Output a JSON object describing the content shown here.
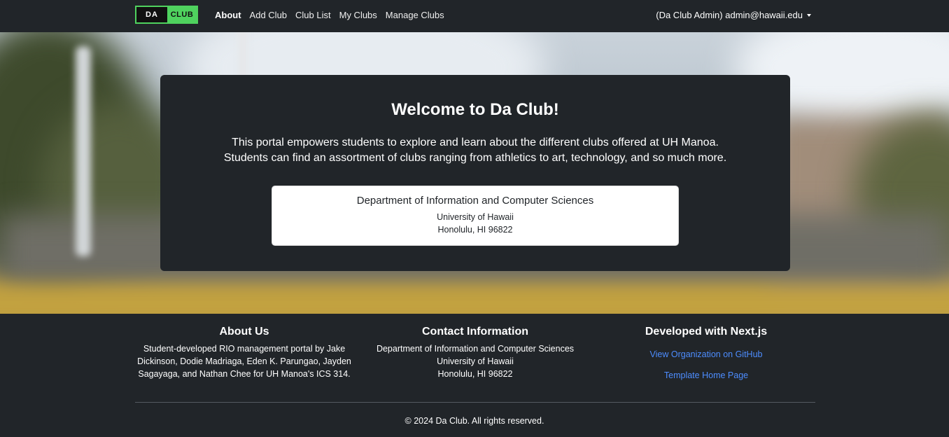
{
  "navbar": {
    "brand_left": "DA",
    "brand_right": "CLUB",
    "links": [
      {
        "label": "About",
        "active": true
      },
      {
        "label": "Add Club",
        "active": false
      },
      {
        "label": "Club List",
        "active": false
      },
      {
        "label": "My Clubs",
        "active": false
      },
      {
        "label": "Manage Clubs",
        "active": false
      }
    ],
    "user": "(Da Club Admin) admin@hawaii.edu"
  },
  "hero": {
    "title": "Welcome to Da Club!",
    "description_line1": "This portal empowers students to explore and learn about the different clubs offered at UH Manoa.",
    "description_line2": "Students can find an assortment of clubs ranging from athletics to art, technology, and so much more.",
    "info": {
      "title": "Department of Information and Computer Sciences",
      "line1": "University of Hawaii",
      "line2": "Honolulu, HI 96822"
    }
  },
  "footer": {
    "about": {
      "heading": "About Us",
      "text": "Student-developed RIO management portal by Jake Dickinson, Dodie Madriaga, Eden K. Parungao, Jayden Sagayaga, and Nathan Chee for UH Manoa's ICS 314."
    },
    "contact": {
      "heading": "Contact Information",
      "line1": "Department of Information and Computer Sciences",
      "line2": "University of Hawaii",
      "line3": "Honolulu, HI 96822"
    },
    "developed": {
      "heading": "Developed with Next.js",
      "link1": "View Organization on GitHub",
      "link2": "Template Home Page"
    },
    "copyright": "© 2024 Da Club. All rights reserved."
  },
  "colors": {
    "dark": "#212529",
    "brand_green": "#4fd25e",
    "link_blue": "#4d8dff"
  }
}
